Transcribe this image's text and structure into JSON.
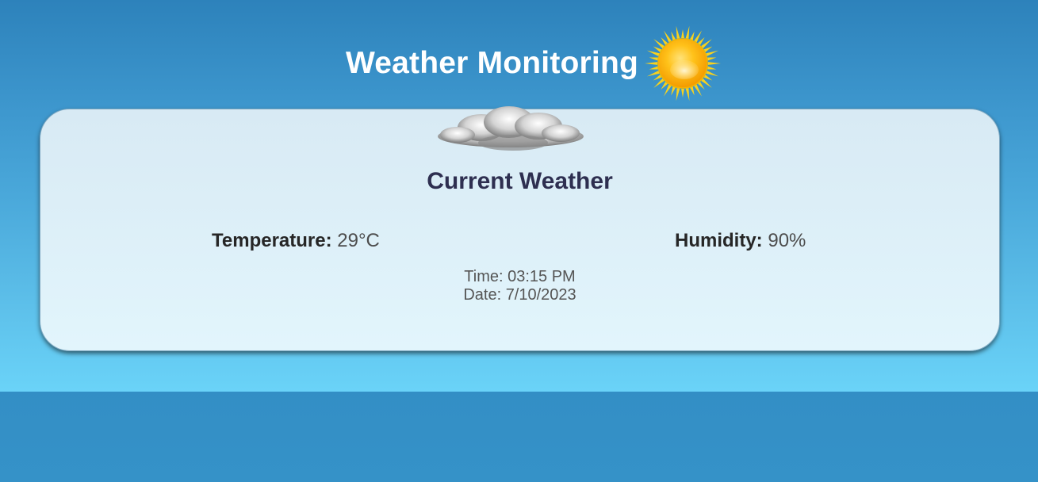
{
  "page": {
    "title": "Weather Monitoring",
    "title_icon": "sun-icon"
  },
  "card": {
    "icon": "cloud-icon",
    "title": "Current Weather",
    "temperature": {
      "label": "Temperature:",
      "value": "29°C"
    },
    "humidity": {
      "label": "Humidity:",
      "value": "90%"
    },
    "time": "Time: 03:15 PM",
    "date": "Date: 7/10/2023"
  },
  "colors": {
    "background_top": "#2d82bb",
    "background_bottom": "#6ad3f8",
    "footer": "#2a7fb8",
    "card_bg": "#dcecf5",
    "title_text": "#ffffff",
    "card_title_text": "#2e2f50"
  }
}
